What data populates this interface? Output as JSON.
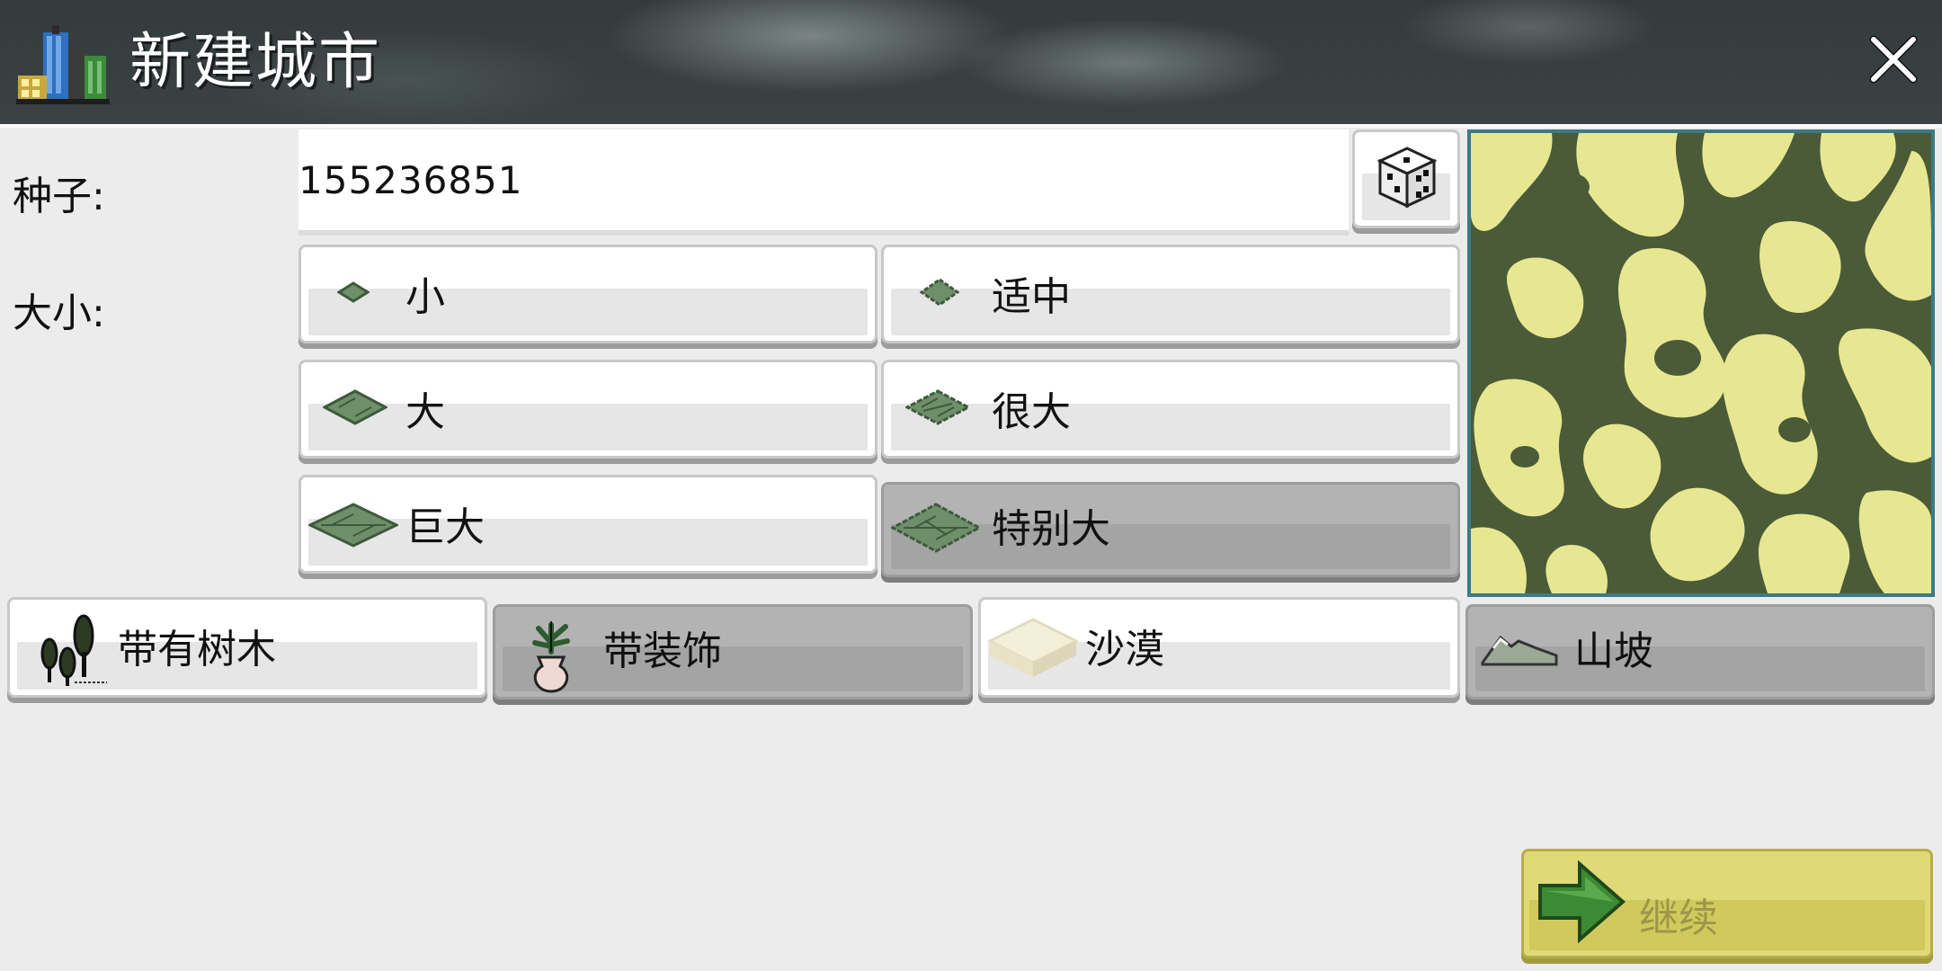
{
  "dialog": {
    "title": "新建城市",
    "close_icon": "close-icon"
  },
  "seed": {
    "label": "种子:",
    "value": "155236851",
    "randomize_icon": "dice-icon"
  },
  "size": {
    "label": "大小:",
    "options": [
      {
        "label": "小",
        "selected": false
      },
      {
        "label": "适中",
        "selected": false
      },
      {
        "label": "大",
        "selected": false
      },
      {
        "label": "很大",
        "selected": false
      },
      {
        "label": "巨大",
        "selected": false
      },
      {
        "label": "特别大",
        "selected": true
      }
    ]
  },
  "toggles": [
    {
      "label": "带有树木",
      "icon": "trees-icon",
      "on": false
    },
    {
      "label": "带装饰",
      "icon": "plant-pot-icon",
      "on": true
    },
    {
      "label": "沙漠",
      "icon": "sand-icon",
      "on": false
    },
    {
      "label": "山坡",
      "icon": "hill-icon",
      "on": true
    }
  ],
  "preview": {
    "land_color": "#e7e792",
    "water_color": "#4b5b38"
  },
  "continue_button": {
    "label": "继续",
    "icon": "arrow-right-icon",
    "enabled": false
  }
}
